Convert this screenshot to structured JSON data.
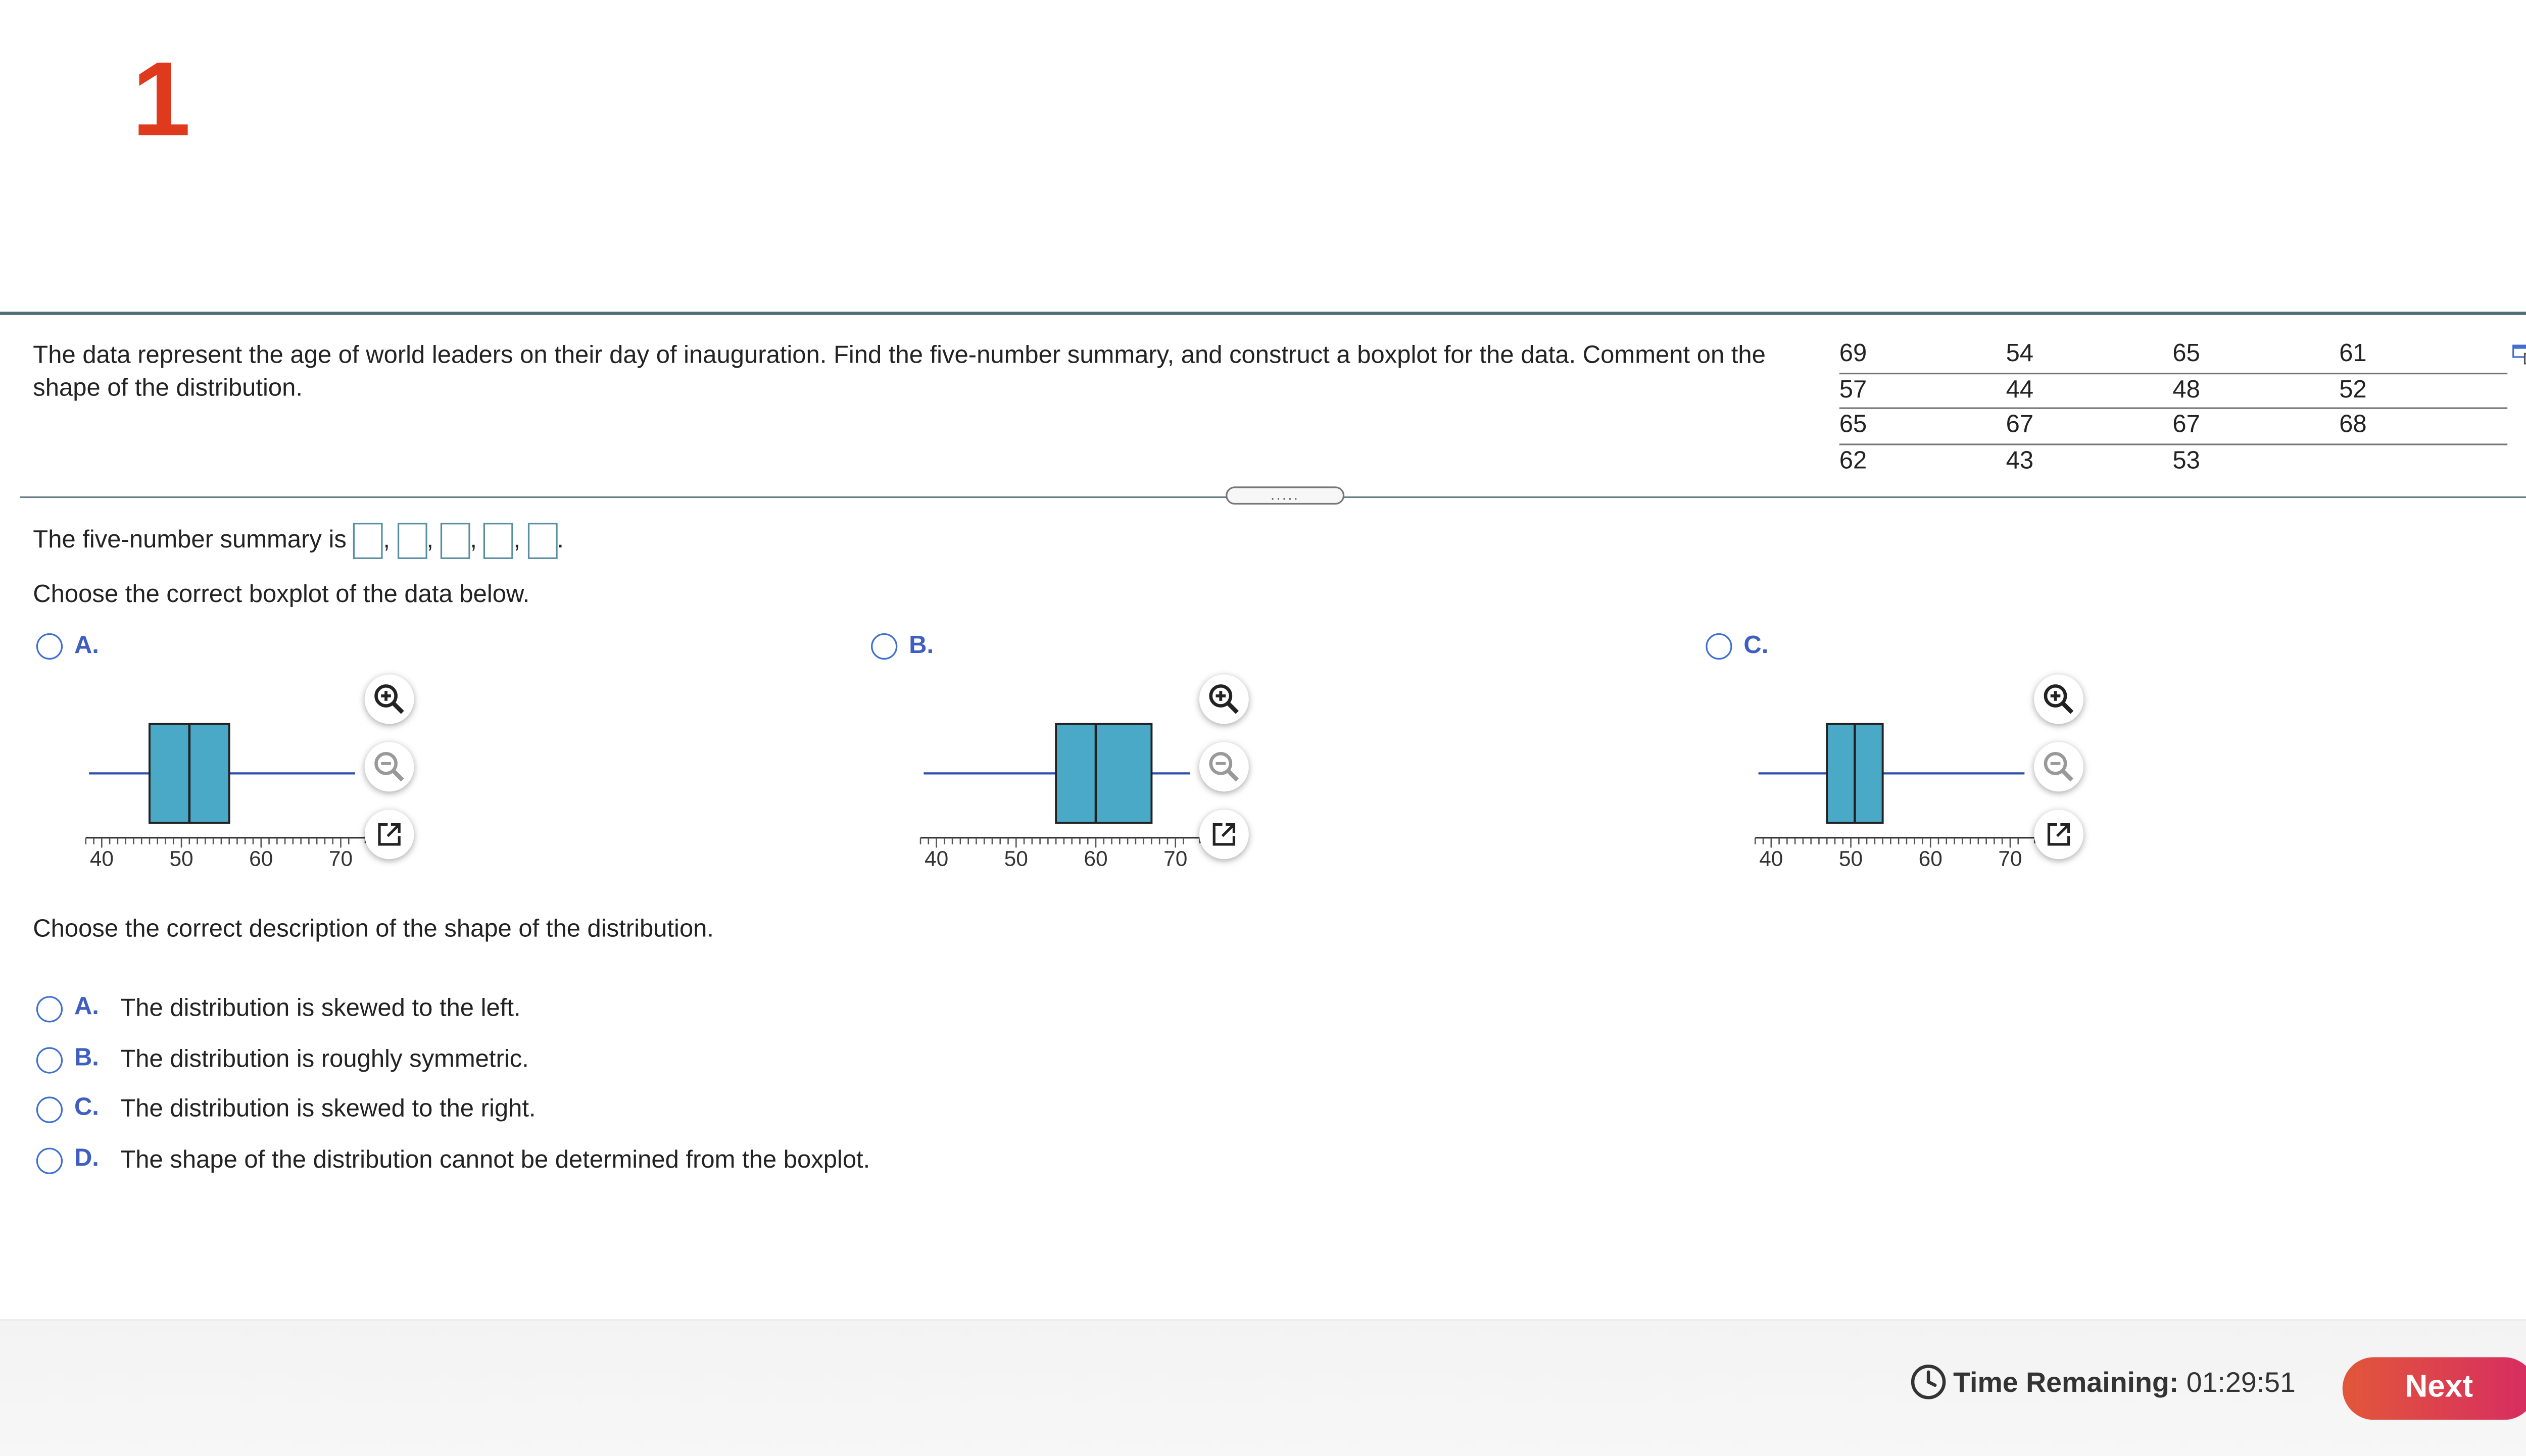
{
  "question": {
    "number": "1",
    "prompt": "The data represent the age of world leaders on their day of inauguration. Find the five-number summary, and construct a boxplot for the data. Comment on the shape of the distribution.",
    "data_rows": [
      [
        "69",
        "54",
        "65",
        "61"
      ],
      [
        "57",
        "44",
        "48",
        "52"
      ],
      [
        "65",
        "67",
        "67",
        "68"
      ],
      [
        "62",
        "43",
        "53",
        ""
      ]
    ]
  },
  "divider_handle": ".....",
  "five_number": {
    "label": "The five-number summary is",
    "separator": ",",
    "end": "."
  },
  "boxplot_question": {
    "label": "Choose the correct boxplot of the data below.",
    "options": [
      {
        "letter": "A.",
        "min": 43,
        "q1": 46,
        "median": 51,
        "q3": 56,
        "max": 68
      },
      {
        "letter": "B.",
        "min": 43,
        "q1": 55,
        "median": 60,
        "q3": 67,
        "max": 68
      },
      {
        "letter": "C.",
        "min": 43,
        "q1": 47,
        "median": 50.5,
        "q3": 54,
        "max": 68
      }
    ],
    "axis_ticks": [
      "40",
      "50",
      "60",
      "70"
    ],
    "axis_range": [
      38,
      73
    ],
    "box_color": "#4aa9c6"
  },
  "shape_question": {
    "label": "Choose the correct description of the shape of the distribution.",
    "options": [
      {
        "letter": "A.",
        "text": "The distribution is skewed to the left."
      },
      {
        "letter": "B.",
        "text": "The distribution is roughly symmetric."
      },
      {
        "letter": "C.",
        "text": "The distribution is skewed to the right."
      },
      {
        "letter": "D.",
        "text": "The shape of the distribution cannot be determined from the boxplot."
      }
    ]
  },
  "footer": {
    "time_label": "Time Remaining:",
    "time_value": "01:29:51",
    "next_label": "Next"
  },
  "colors": {
    "accent": "#3f5fc0",
    "question_number": "#e03a1e",
    "next_button": "#dc3f52"
  }
}
